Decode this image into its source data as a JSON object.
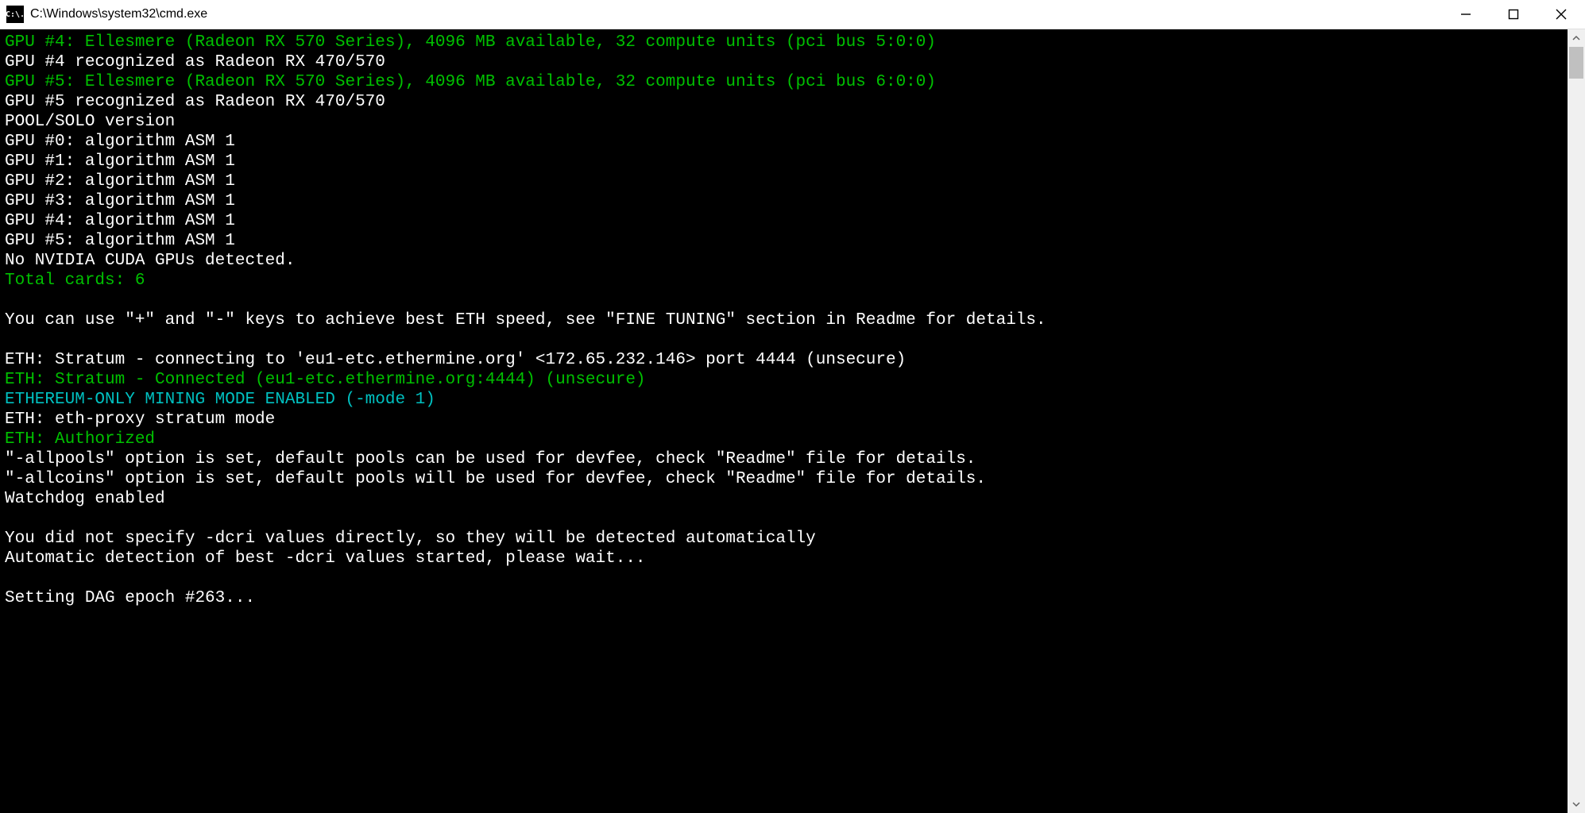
{
  "window": {
    "icon_text": "C:\\.",
    "title": "C:\\Windows\\system32\\cmd.exe"
  },
  "terminal": {
    "lines": [
      {
        "color": "green",
        "text": "GPU #4: Ellesmere (Radeon RX 570 Series), 4096 MB available, 32 compute units (pci bus 5:0:0)"
      },
      {
        "color": "white",
        "text": "GPU #4 recognized as Radeon RX 470/570"
      },
      {
        "color": "green",
        "text": "GPU #5: Ellesmere (Radeon RX 570 Series), 4096 MB available, 32 compute units (pci bus 6:0:0)"
      },
      {
        "color": "white",
        "text": "GPU #5 recognized as Radeon RX 470/570"
      },
      {
        "color": "white",
        "text": "POOL/SOLO version"
      },
      {
        "color": "white",
        "text": "GPU #0: algorithm ASM 1"
      },
      {
        "color": "white",
        "text": "GPU #1: algorithm ASM 1"
      },
      {
        "color": "white",
        "text": "GPU #2: algorithm ASM 1"
      },
      {
        "color": "white",
        "text": "GPU #3: algorithm ASM 1"
      },
      {
        "color": "white",
        "text": "GPU #4: algorithm ASM 1"
      },
      {
        "color": "white",
        "text": "GPU #5: algorithm ASM 1"
      },
      {
        "color": "white",
        "text": "No NVIDIA CUDA GPUs detected."
      },
      {
        "color": "green",
        "text": "Total cards: 6"
      },
      {
        "color": "white",
        "text": ""
      },
      {
        "color": "white",
        "text": "You can use \"+\" and \"-\" keys to achieve best ETH speed, see \"FINE TUNING\" section in Readme for details."
      },
      {
        "color": "white",
        "text": ""
      },
      {
        "color": "white",
        "text": "ETH: Stratum - connecting to 'eu1-etc.ethermine.org' <172.65.232.146> port 4444 (unsecure)"
      },
      {
        "color": "green",
        "text": "ETH: Stratum - Connected (eu1-etc.ethermine.org:4444) (unsecure)"
      },
      {
        "color": "cyan",
        "text": "ETHEREUM-ONLY MINING MODE ENABLED (-mode 1)"
      },
      {
        "color": "white",
        "text": "ETH: eth-proxy stratum mode"
      },
      {
        "color": "green",
        "text": "ETH: Authorized"
      },
      {
        "color": "white",
        "text": "\"-allpools\" option is set, default pools can be used for devfee, check \"Readme\" file for details."
      },
      {
        "color": "white",
        "text": "\"-allcoins\" option is set, default pools will be used for devfee, check \"Readme\" file for details."
      },
      {
        "color": "white",
        "text": "Watchdog enabled"
      },
      {
        "color": "white",
        "text": ""
      },
      {
        "color": "white",
        "text": "You did not specify -dcri values directly, so they will be detected automatically"
      },
      {
        "color": "white",
        "text": "Automatic detection of best -dcri values started, please wait..."
      },
      {
        "color": "white",
        "text": ""
      },
      {
        "color": "white",
        "text": "Setting DAG epoch #263..."
      }
    ]
  }
}
